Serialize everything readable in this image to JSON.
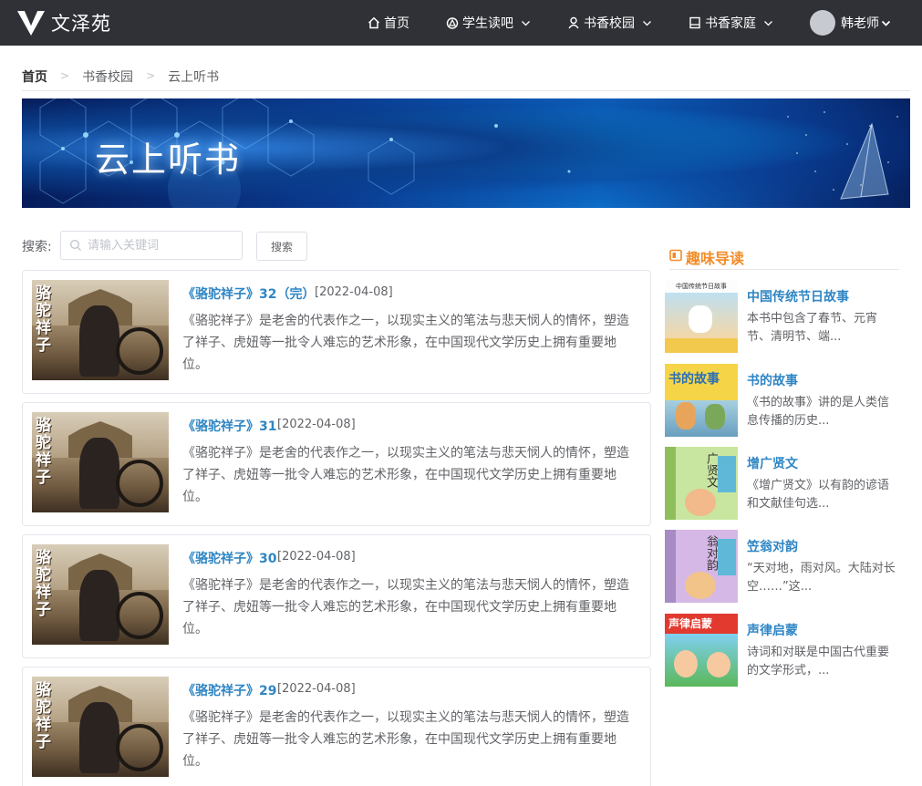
{
  "nav": {
    "brand": "文泽苑",
    "items": [
      {
        "label": "首页",
        "icon": "home-icon",
        "dropdown": false
      },
      {
        "label": "学生读吧",
        "icon": "triangle-logo-icon",
        "dropdown": true
      },
      {
        "label": "书香校园",
        "icon": "user-icon",
        "dropdown": true
      },
      {
        "label": "书香家庭",
        "icon": "book-icon",
        "dropdown": true
      }
    ],
    "user": "韩老师"
  },
  "breadcrumb": [
    "首页",
    "书香校园",
    "云上听书"
  ],
  "banner": {
    "title": "云上听书"
  },
  "search": {
    "label": "搜索:",
    "placeholder": "请输入关键词",
    "button": "搜索"
  },
  "list": [
    {
      "title": "《骆驼祥子》32（完）",
      "date": "[2022-04-08]",
      "desc": "《骆驼祥子》是老舍的代表作之一，以现实主义的笔法与悲天悯人的情怀，塑造了祥子、虎妞等一批令人难忘的艺术形象，在中国现代文学历史上拥有重要地位。",
      "thumb_text": "骆驼祥子"
    },
    {
      "title": "《骆驼祥子》31",
      "date": "[2022-04-08]",
      "desc": "《骆驼祥子》是老舍的代表作之一，以现实主义的笔法与悲天悯人的情怀，塑造了祥子、虎妞等一批令人难忘的艺术形象，在中国现代文学历史上拥有重要地位。",
      "thumb_text": "骆驼祥子"
    },
    {
      "title": "《骆驼祥子》30",
      "date": "[2022-04-08]",
      "desc": "《骆驼祥子》是老舍的代表作之一，以现实主义的笔法与悲天悯人的情怀，塑造了祥子、虎妞等一批令人难忘的艺术形象，在中国现代文学历史上拥有重要地位。",
      "thumb_text": "骆驼祥子"
    },
    {
      "title": "《骆驼祥子》29",
      "date": "[2022-04-08]",
      "desc": "《骆驼祥子》是老舍的代表作之一，以现实主义的笔法与悲天悯人的情怀，塑造了祥子、虎妞等一批令人难忘的艺术形象，在中国现代文学历史上拥有重要地位。",
      "thumb_text": "骆驼祥子"
    }
  ],
  "sidebar": {
    "heading": "趣味导读",
    "items": [
      {
        "title": "中国传统节日故事",
        "desc": "本书中包含了春节、元宵节、清明节、端...",
        "cover_text": "中国传统节日故事"
      },
      {
        "title": "书的故事",
        "desc": "《书的故事》讲的是人类信息传播的历史...",
        "cover_text": "书的故事"
      },
      {
        "title": "增广贤文",
        "desc": "《增广贤文》以有韵的谚语和文献佳句选...",
        "cover_text": "广贤文"
      },
      {
        "title": "笠翁对韵",
        "desc": "“天对地，雨对风。大陆对长空……”这...",
        "cover_text": "翁对韵"
      },
      {
        "title": "声律启蒙",
        "desc": "诗词和对联是中国古代重要的文学形式，...",
        "cover_text": "声律启蒙"
      }
    ]
  },
  "colors": {
    "nav_bg": "#2f3136",
    "link": "#2f86c4",
    "accent": "#f28c28"
  }
}
